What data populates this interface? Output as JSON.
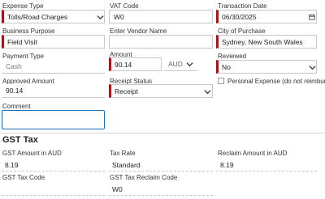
{
  "expense": {
    "expense_type": {
      "label": "Expense Type",
      "value": "Tolls/Road Charges"
    },
    "vat_code": {
      "label": "VAT Code",
      "value": "W0"
    },
    "transaction_date": {
      "label": "Transaction Date",
      "value": "06/30/2025"
    },
    "business_purpose": {
      "label": "Business Purpose",
      "value": "Field Visit"
    },
    "vendor_name": {
      "label": "Enter Vendor Name",
      "value": ""
    },
    "city_of_purchase": {
      "label": "City of Purchase",
      "value": "Sydney, New South Wales"
    },
    "payment_type": {
      "label": "Payment Type",
      "value": "Cash"
    },
    "amount": {
      "label": "Amount",
      "value": "90.14",
      "currency": "AUD"
    },
    "reviewed": {
      "label": "Reviewed",
      "value": "No"
    },
    "approved_amount": {
      "label": "Approved Amount",
      "value": "90.14"
    },
    "receipt_status": {
      "label": "Receipt Status",
      "value": "Receipt"
    },
    "personal_expense": {
      "label": "Personal Expense (do not reimburse)",
      "checked": false
    },
    "comment": {
      "label": "Comment",
      "value": ""
    }
  },
  "gst": {
    "title": "GST Tax",
    "gst_amount": {
      "label": "GST Amount in AUD",
      "value": "8.19"
    },
    "tax_rate": {
      "label": "Tax Rate",
      "value": "Standard"
    },
    "reclaim_amount": {
      "label": "Reclaim Amount in AUD",
      "value": "8.19"
    },
    "gst_tax_code": {
      "label": "GST Tax Code",
      "value": ""
    },
    "gst_reclaim_code": {
      "label": "GST Tax Reclaim Code",
      "value": "W0"
    }
  },
  "colors": {
    "required_marker": "#a3171b",
    "focus_border": "#1d6fb8"
  }
}
